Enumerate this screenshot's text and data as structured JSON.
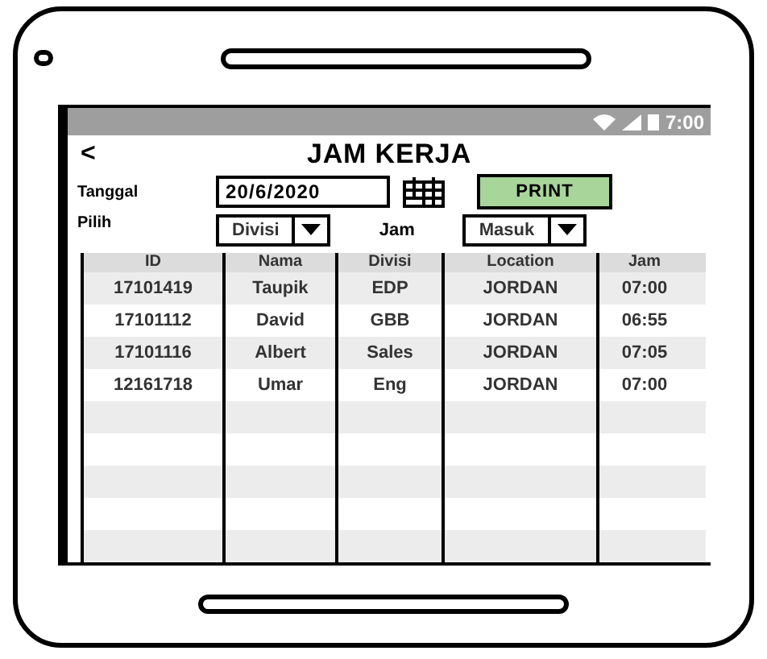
{
  "status_bar": {
    "time": "7:00"
  },
  "header": {
    "back": "<",
    "title": "JAM KERJA"
  },
  "form": {
    "date_label": "Tanggal",
    "date_value": "20/6/2020",
    "print_button": "PRINT",
    "pilih_label": "Pilih",
    "division_select": "Divisi",
    "jam_label": "Jam",
    "jam_select": "Masuk"
  },
  "table": {
    "columns": [
      "ID",
      "Nama",
      "Divisi",
      "Location",
      "Jam"
    ],
    "rows": [
      [
        "17101419",
        "Taupik",
        "EDP",
        "JORDAN",
        "07:00"
      ],
      [
        "17101112",
        "David",
        "GBB",
        "JORDAN",
        "06:55"
      ],
      [
        "17101116",
        "Albert",
        "Sales",
        "JORDAN",
        "07:05"
      ],
      [
        "12161718",
        "Umar",
        "Eng",
        "JORDAN",
        "07:00"
      ]
    ]
  }
}
